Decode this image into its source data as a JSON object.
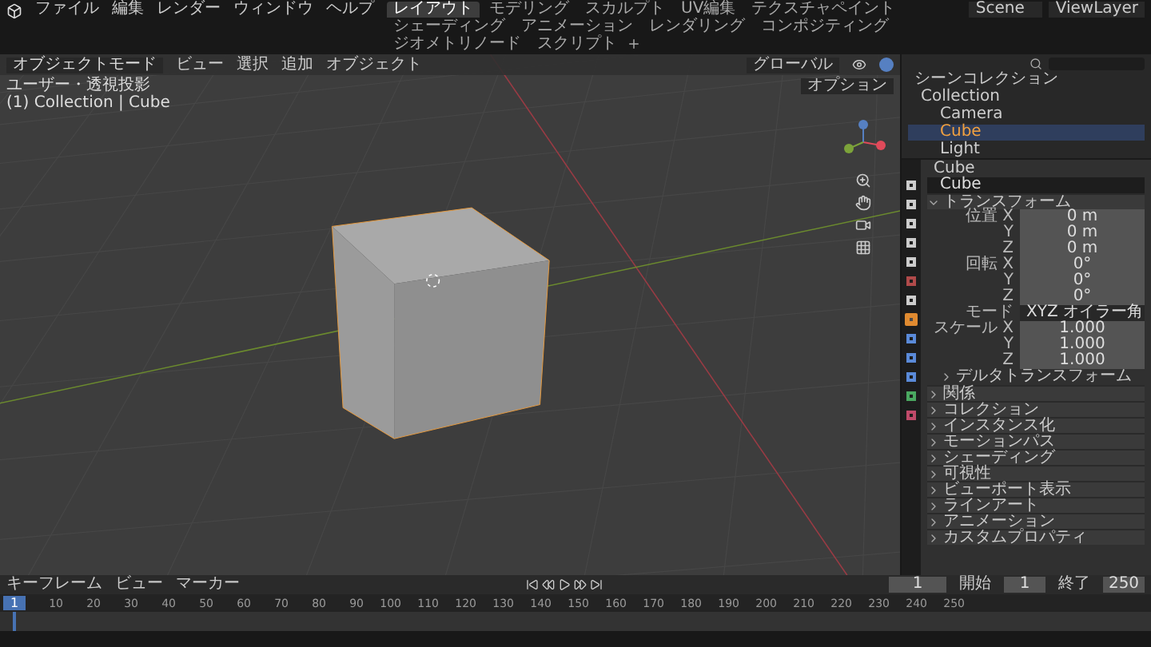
{
  "menu": [
    "ファイル",
    "編集",
    "レンダー",
    "ウィンドウ",
    "ヘルプ"
  ],
  "workspaces": [
    {
      "label": "レイアウト",
      "selected": true
    },
    {
      "label": "モデリング",
      "selected": false
    },
    {
      "label": "スカルプト",
      "selected": false
    },
    {
      "label": "UV編集",
      "selected": false
    },
    {
      "label": "テクスチャペイント",
      "selected": false
    },
    {
      "label": "シェーディング",
      "selected": false
    },
    {
      "label": "アニメーション",
      "selected": false
    },
    {
      "label": "レンダリング",
      "selected": false
    },
    {
      "label": "コンポジティング",
      "selected": false
    },
    {
      "label": "ジオメトリノード",
      "selected": false
    },
    {
      "label": "スクリプト",
      "selected": false
    }
  ],
  "scene": "Scene",
  "view_layer": "ViewLayer",
  "viewport": {
    "mode": "オブジェクトモード",
    "menus": [
      "ビュー",
      "選択",
      "追加",
      "オブジェクト"
    ],
    "orientation": "グローバル",
    "options": "オプション",
    "view_name": "ユーザー・透視投影",
    "context": "(1) Collection | Cube"
  },
  "outliner": {
    "root": "シーンコレクション",
    "collection": "Collection",
    "items": [
      {
        "label": "Camera",
        "selected": false
      },
      {
        "label": "Cube",
        "selected": true
      },
      {
        "label": "Light",
        "selected": false
      }
    ]
  },
  "properties": {
    "tabs": [
      {
        "selected": false
      },
      {
        "selected": false
      },
      {
        "selected": false
      },
      {
        "selected": false
      },
      {
        "selected": false
      },
      {
        "selected": false
      },
      {
        "selected": false
      },
      {
        "selected": true
      },
      {
        "selected": false
      },
      {
        "selected": false
      },
      {
        "selected": false
      },
      {
        "selected": false
      },
      {
        "selected": false
      }
    ],
    "object_name": "Cube",
    "data_name": "Cube",
    "rows": [
      {
        "kind": "header",
        "label": "トランスフォーム",
        "expanded": true
      },
      {
        "kind": "field",
        "label": "位置 X",
        "value": "0 m"
      },
      {
        "kind": "field",
        "label": "Y",
        "value": "0 m"
      },
      {
        "kind": "field",
        "label": "Z",
        "value": "0 m"
      },
      {
        "kind": "field",
        "label": "回転 X",
        "value": "0°"
      },
      {
        "kind": "field",
        "label": "Y",
        "value": "0°"
      },
      {
        "kind": "field",
        "label": "Z",
        "value": "0°"
      },
      {
        "kind": "dropdown",
        "label": "モード",
        "value": "XYZ オイラー角"
      },
      {
        "kind": "field",
        "label": "スケール X",
        "value": "1.000"
      },
      {
        "kind": "field",
        "label": "Y",
        "value": "1.000"
      },
      {
        "kind": "field",
        "label": "Z",
        "value": "1.000"
      },
      {
        "kind": "subheader",
        "label": "デルタトランスフォーム",
        "expanded": false
      },
      {
        "kind": "header",
        "label": "関係",
        "expanded": false
      },
      {
        "kind": "header",
        "label": "コレクション",
        "expanded": false
      },
      {
        "kind": "header",
        "label": "インスタンス化",
        "expanded": false
      },
      {
        "kind": "header",
        "label": "モーションパス",
        "expanded": false
      },
      {
        "kind": "header",
        "label": "シェーディング",
        "expanded": false
      },
      {
        "kind": "header",
        "label": "可視性",
        "expanded": false
      },
      {
        "kind": "header",
        "label": "ビューポート表示",
        "expanded": false
      },
      {
        "kind": "header",
        "label": "ラインアート",
        "expanded": false
      },
      {
        "kind": "header",
        "label": "アニメーション",
        "expanded": false
      },
      {
        "kind": "header",
        "label": "カスタムプロパティ",
        "expanded": false
      }
    ]
  },
  "timeline": {
    "menus": [
      "キーフレーム",
      "ビュー",
      "マーカー"
    ],
    "current_frame": "1",
    "playhead_frame": "1",
    "start_label": "開始",
    "start": "1",
    "end_label": "終了",
    "end": "250",
    "ruler": [
      "10",
      "20",
      "30",
      "40",
      "50",
      "60",
      "70",
      "80",
      "90",
      "100",
      "110",
      "120",
      "130",
      "140",
      "150",
      "160",
      "170",
      "180",
      "190",
      "200",
      "210",
      "220",
      "230",
      "240",
      "250"
    ]
  }
}
